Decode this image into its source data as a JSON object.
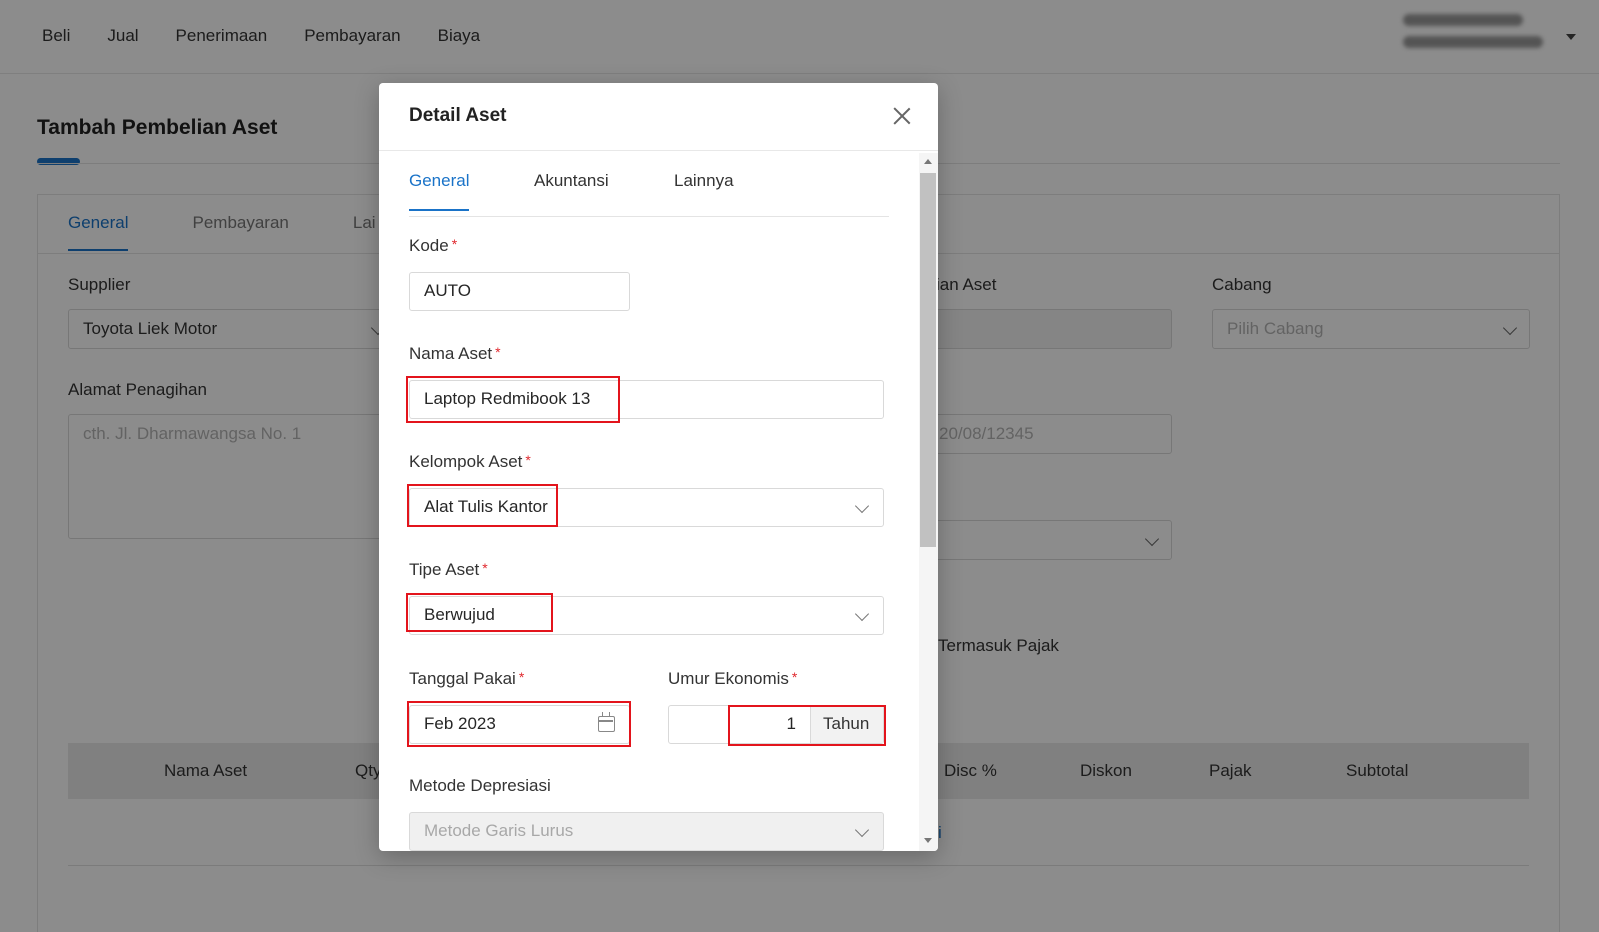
{
  "topnav": [
    "Beli",
    "Jual",
    "Penerimaan",
    "Pembayaran",
    "Biaya"
  ],
  "page": {
    "title": "Tambah Pembelian Aset",
    "tabs": [
      "General",
      "Pembayaran",
      "Lai"
    ],
    "supplier_label": "Supplier",
    "supplier_value": "Toyota Liek Motor",
    "alamat_label": "Alamat Penagihan",
    "alamat_placeholder": "cth. Jl. Dharmawangsa No. 1",
    "mid_label_partial": "ian Aset",
    "cabang_label": "Cabang",
    "cabang_placeholder": "Pilih Cabang",
    "mid_field_partial": "20/08/12345",
    "pajak_label_partial": "Termasuk Pajak",
    "table_headers": [
      "Nama Aset",
      "Qty",
      "Disc %",
      "Diskon",
      "Pajak",
      "Subtotal"
    ],
    "link_partial": "i"
  },
  "modal": {
    "title": "Detail Aset",
    "tabs": [
      "General",
      "Akuntansi",
      "Lainnya"
    ],
    "kode_label": "Kode",
    "kode_value": "AUTO",
    "nama_label": "Nama Aset",
    "nama_value": "Laptop Redmibook 13",
    "kelompok_label": "Kelompok Aset",
    "kelompok_value": "Alat Tulis Kantor",
    "tipe_label": "Tipe Aset",
    "tipe_value": "Berwujud",
    "tanggal_label": "Tanggal Pakai",
    "tanggal_value": "Feb 2023",
    "umur_label": "Umur Ekonomis",
    "umur_value": "1",
    "umur_unit": "Tahun",
    "metode_label": "Metode Depresiasi",
    "metode_value": "Metode Garis Lurus",
    "required_mark": "*"
  },
  "colors": {
    "accent": "#1a73c8",
    "highlight": "#e3141c",
    "required": "#e0282e"
  },
  "icons": [
    "close-icon",
    "chevron-down-icon",
    "calendar-icon"
  ]
}
